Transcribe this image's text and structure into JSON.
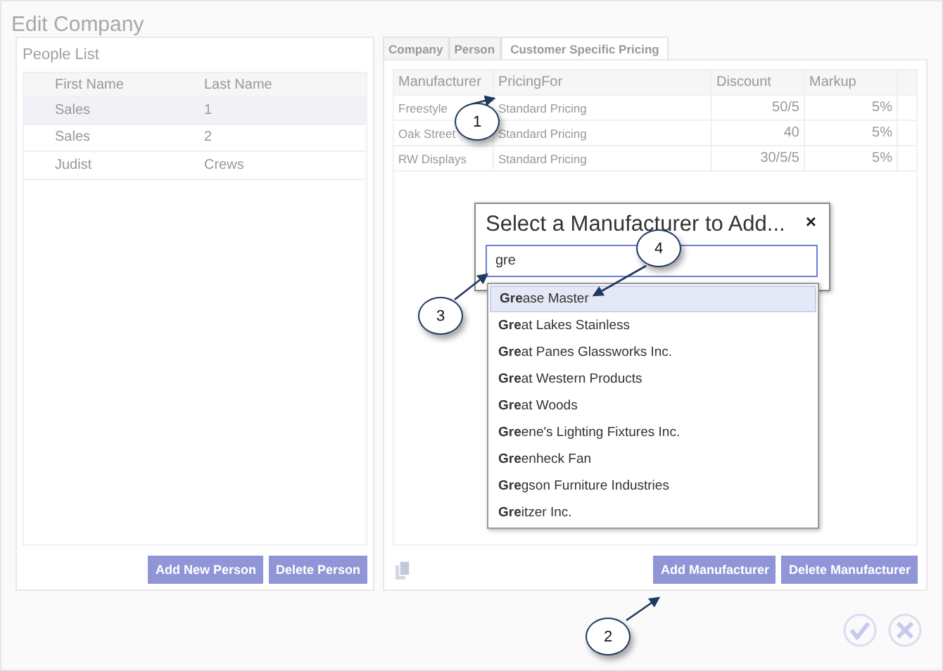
{
  "window": {
    "title": "Edit Company"
  },
  "people_list": {
    "title": "People List",
    "columns": [
      "First Name",
      "Last Name"
    ],
    "rows": [
      {
        "first_name": "Sales",
        "last_name": "1",
        "selected": true
      },
      {
        "first_name": "Sales",
        "last_name": "2",
        "selected": false
      },
      {
        "first_name": "Judist",
        "last_name": "Crews",
        "selected": false
      }
    ],
    "buttons": [
      "Add New Person",
      "Delete Person"
    ]
  },
  "tabs": [
    {
      "label": "Company",
      "selected": false
    },
    {
      "label": "Person",
      "selected": false
    },
    {
      "label": "Customer Specific Pricing",
      "selected": true
    }
  ],
  "pricing_table": {
    "columns": [
      "Manufacturer",
      "PricingFor",
      "Discount",
      "Markup"
    ],
    "rows": [
      {
        "manufacturer": "Freestyle",
        "pricing_for": "Standard Pricing",
        "discount": "50/5",
        "markup": "5%"
      },
      {
        "manufacturer": "Oak Street",
        "pricing_for": "Standard Pricing",
        "discount": "40",
        "markup": "5%"
      },
      {
        "manufacturer": "RW Displays",
        "pricing_for": "Standard Pricing",
        "discount": "30/5/5",
        "markup": "5%"
      }
    ],
    "buttons": [
      "Add Manufacturer",
      "Delete Manufacturer"
    ]
  },
  "dialog": {
    "title": "Select a Manufacturer to Add...",
    "close": "×",
    "search_value": "gre",
    "suggestions": [
      {
        "label": "**Gre**ase Master",
        "selected": true
      },
      {
        "label": "**Gre**at Lakes Stainless",
        "selected": false
      },
      {
        "label": "**Gre**at Panes Glassworks Inc.",
        "selected": false
      },
      {
        "label": "**Gre**at Western Products",
        "selected": false
      },
      {
        "label": "**Gre**at Woods",
        "selected": false
      },
      {
        "label": "**Gre**ene's Lighting Fixtures Inc.",
        "selected": false
      },
      {
        "label": "**Gre**enheck Fan",
        "selected": false
      },
      {
        "label": "**Gre**gson Furniture Industries",
        "selected": false
      },
      {
        "label": "**Gre**itzer Inc.",
        "selected": false
      }
    ]
  },
  "callouts": [
    "1",
    "2",
    "3",
    "4"
  ]
}
